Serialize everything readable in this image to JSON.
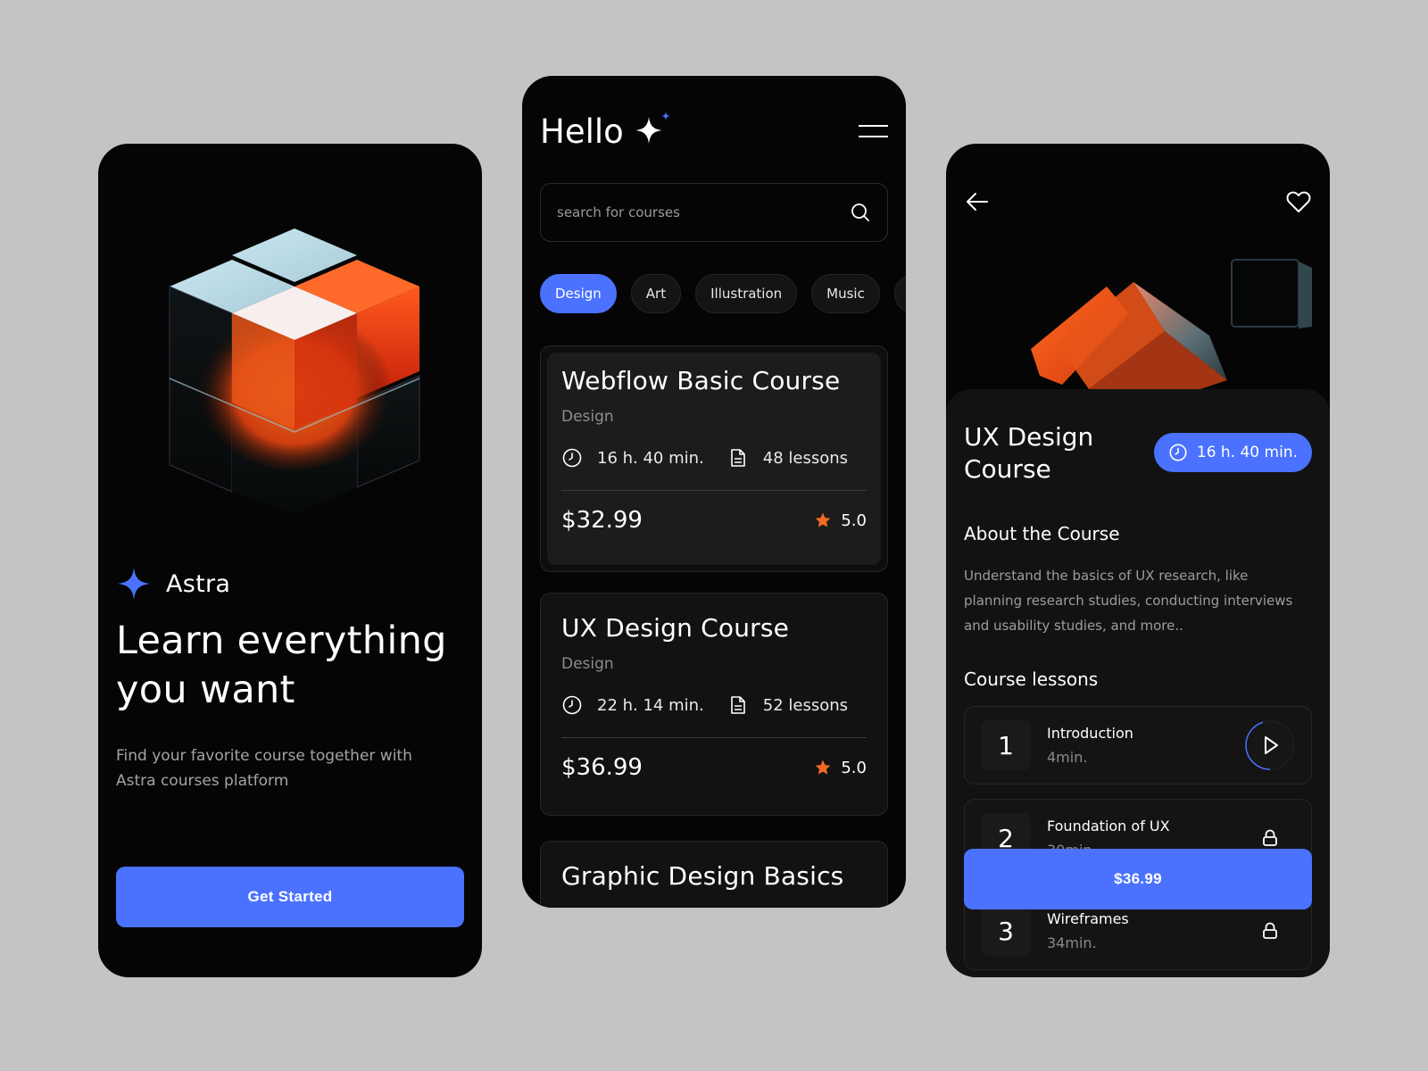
{
  "colors": {
    "accent": "#4a72ff",
    "background": "#c4c4c4",
    "star": "#f06a24"
  },
  "welcome": {
    "brand_name": "Astra",
    "title": "Learn everything you want",
    "subtitle": "Find your favorite course together with Astra courses platform",
    "cta_label": "Get Started",
    "hero_icon": "cubes-3d-illustration"
  },
  "home": {
    "greeting": "Hello",
    "greeting_icon": "sparkle-icon",
    "menu_icon": "hamburger-menu-icon",
    "search": {
      "placeholder": "search for courses",
      "value": "",
      "icon": "search-icon"
    },
    "categories": [
      {
        "label": "Design",
        "active": true
      },
      {
        "label": "Art",
        "active": false
      },
      {
        "label": "Illustration",
        "active": false
      },
      {
        "label": "Music",
        "active": false
      }
    ],
    "courses": [
      {
        "title": "Webflow Basic Course",
        "category": "Design",
        "duration": "16 h. 40 min.",
        "lessons": "48 lessons",
        "price": "$32.99",
        "rating": "5.0"
      },
      {
        "title": "UX Design Course",
        "category": "Design",
        "duration": "22 h. 14 min.",
        "lessons": "52 lessons",
        "price": "$36.99",
        "rating": "5.0"
      },
      {
        "title": "Graphic Design Basics"
      }
    ]
  },
  "detail": {
    "back_icon": "arrow-left-icon",
    "favorite_icon": "heart-icon",
    "title": "UX Design Course",
    "duration": "16 h. 40 min.",
    "about_heading": "About the Course",
    "about_text": "Understand the basics of UX research, like planning research studies, conducting interviews and usability studies, and more..",
    "lessons_heading": "Course lessons",
    "lessons": [
      {
        "number": "1",
        "title": "Introduction",
        "duration": "4min.",
        "state": "playable",
        "progress": 0.45
      },
      {
        "number": "2",
        "title": "Foundation of UX",
        "duration": "30min.",
        "state": "locked"
      },
      {
        "number": "3",
        "title": "Wireframes",
        "duration": "34min.",
        "state": "locked"
      }
    ],
    "buy_label": "$36.99"
  }
}
